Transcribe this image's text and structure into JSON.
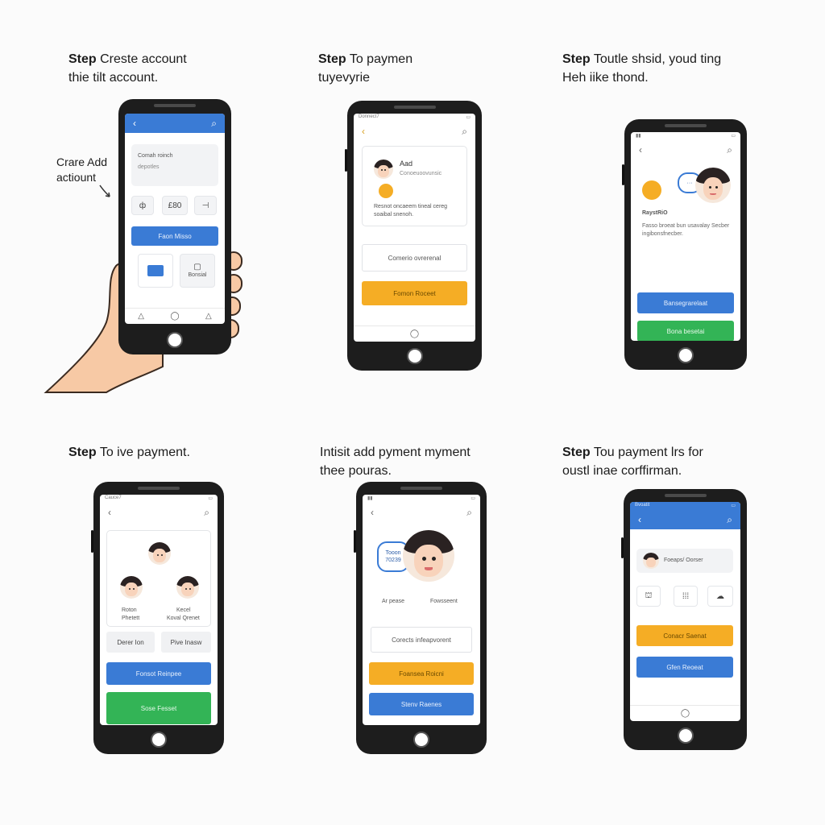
{
  "steps": [
    {
      "caption_bold": "Step",
      "caption_line1": " Creste account",
      "caption_line2": "thie tilt account.",
      "annotation": "Crare Add actiount",
      "card_title": "Comah roinch",
      "card_subtitle": "depotles",
      "tiles": [
        "ф",
        "£80",
        "⊣"
      ],
      "button": "Faon Misso",
      "chat_tile": "Bonsial",
      "nav": [
        "△",
        "◯",
        "△"
      ]
    },
    {
      "caption_bold": "Step",
      "caption_line1": " To paymen",
      "caption_line2": "tuyevyrie",
      "status": "Donnect7",
      "name": "Aad",
      "name_sub": "Conoeuoovunsic",
      "desc": "Resnot oncaeem tineal cereg soaibal snenoh.",
      "outline_btn": "Comerio ovrerenal",
      "button": "Fomon Roceet"
    },
    {
      "caption_bold": "Step",
      "caption_line1": " Toutle shsid, youd ting",
      "caption_line2": "Heh iike thond.",
      "label": "RaystRiO",
      "desc": "Fasso broeat bun usavalay Secber ingibonsfnecber.",
      "button_blue": "Bansegrarelaat",
      "button_green": "Bona besetai"
    },
    {
      "caption_bold": "Step",
      "caption_line1": " To ive payment.",
      "status": "Cauce7",
      "person_left_name": "Roton",
      "person_left_sub": "Phetett",
      "person_right_name": "Kecel",
      "person_right_sub": "Koval Qrenet",
      "small_btn_left": "Derer Ion",
      "small_btn_right": "Pive Inasw",
      "button_blue": "Fonsot Reinpee",
      "button_green": "Sose Fesset"
    },
    {
      "caption_line1": "Intisit add pyment myment",
      "caption_line2": "thee pouras.",
      "bubble_line1": "Tooon",
      "bubble_line2": "70239",
      "left_label": "Ar pease",
      "right_label": "Fowsseent",
      "outline_btn": "Corects infeapvorent",
      "button_orange": "Foansea Roicni",
      "button_blue": "Stenv Raenes"
    },
    {
      "caption_bold": "Step",
      "caption_line1": " Tou payment lrs for",
      "caption_line2": "oustl inae corffirman.",
      "status": "Bvoatit",
      "contact": "Foeaps/ Oorser",
      "tiles": [
        "⛫",
        "⁞⁞⁞",
        "☁"
      ],
      "button_orange": "Conacr Saenat",
      "button_blue": "Gfen Reoeat"
    }
  ],
  "colors": {
    "blue": "#3a7bd5",
    "orange": "#f5ad25",
    "green": "#33b456",
    "frame": "#1d1d1d"
  }
}
